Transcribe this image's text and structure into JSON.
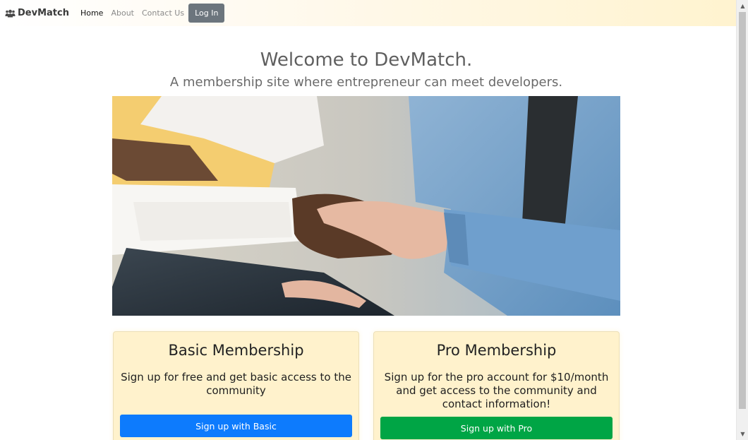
{
  "navbar": {
    "brand": "DevMatch",
    "brand_icon": "users-icon",
    "links": {
      "home": "Home",
      "about": "About",
      "contact": "Contact Us"
    },
    "login_label": "Log In"
  },
  "hero": {
    "title": "Welcome to DevMatch.",
    "subtitle": "A membership site where entrepreneur can meet developers."
  },
  "cards": {
    "basic": {
      "title": "Basic Membership",
      "text": "Sign up for free and get basic access to the community",
      "button": "Sign up with Basic"
    },
    "pro": {
      "title": "Pro Membership",
      "text": "Sign up for the pro account for $10/month and get access to the community and contact information!",
      "button": "Sign up with Pro"
    }
  },
  "colors": {
    "basic_button": "#0d7bfd",
    "pro_button": "#00a545",
    "login_button": "#6c757d",
    "card_background": "#fff2cc"
  }
}
